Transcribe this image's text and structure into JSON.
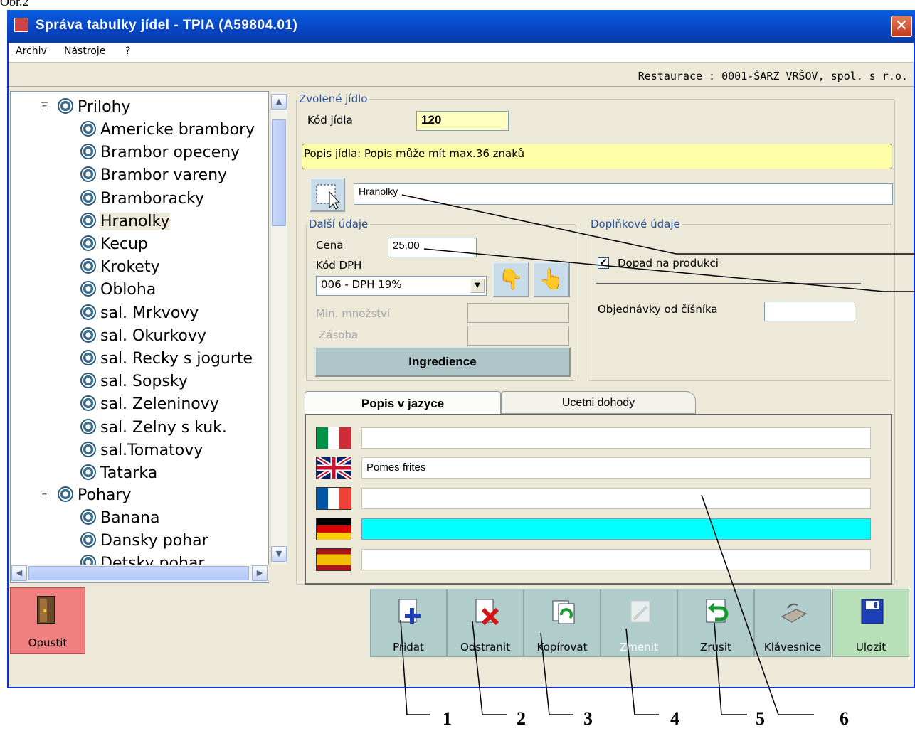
{
  "figure_label": "Obr.2",
  "window": {
    "title": "Správa tabulky jídel - TPIA (A59804.01)",
    "close_label": "✕"
  },
  "menu": [
    "Archiv",
    "Nástroje",
    "?"
  ],
  "restaurant": "Restaurace : 0001-ŠARZ VRŠOV, spol. s r.o.",
  "tree": {
    "groups": [
      {
        "label": "Prilohy",
        "items": [
          "Americke brambory",
          "Brambor opeceny",
          "Brambor vareny",
          "Bramboracky",
          "Hranolky",
          "Kecup",
          "Krokety",
          "Obloha",
          "sal. Mrkvovy",
          "sal. Okurkovy",
          "sal. Recky s jogurte",
          "sal. Sopsky",
          "sal. Zeleninovy",
          "sal. Zelny s kuk.",
          "sal.Tomatovy",
          "Tatarka"
        ]
      },
      {
        "label": "Pohary",
        "items": [
          "Banana",
          "Dansky pohar",
          "Detsky pohar"
        ]
      }
    ],
    "selected": "Hranolky"
  },
  "selected_food": {
    "legend": "Zvolené jídlo",
    "code_label": "Kód jídla",
    "code_value": "120",
    "hint": "Popis jídla: Popis může mít max.36 znaků",
    "description": "Hranolky"
  },
  "other_data": {
    "legend": "Další údaje",
    "price_label": "Cena",
    "price_value": "25,00",
    "vat_label": "Kód DPH",
    "vat_value": "006 - DPH 19%",
    "min_label": "Min. množství",
    "stock_label": "Zásoba",
    "ingredients_label": "Ingredience"
  },
  "extra_data": {
    "legend": "Doplňkové údaje",
    "production_label": "Dopad na produkci",
    "production_checked": true,
    "waiter_label": "Objednávky od číšníka"
  },
  "tabs": {
    "active": "Popis v jazyce",
    "other": "Ucetni dohody"
  },
  "languages": [
    {
      "flag": "italy",
      "value": ""
    },
    {
      "flag": "uk",
      "value": "Pomes frites"
    },
    {
      "flag": "france",
      "value": ""
    },
    {
      "flag": "germany",
      "value": ""
    },
    {
      "flag": "spain",
      "value": ""
    }
  ],
  "toolbar": {
    "quit": "Opustit",
    "buttons": [
      "Pridat",
      "Odstranit",
      "Kopírovat",
      "Zmenit",
      "Zrusit",
      "Klávesnice",
      "Ulozit"
    ]
  },
  "callouts": [
    "1",
    "2",
    "3",
    "4",
    "5",
    "6"
  ],
  "colors": {
    "titlebar": "#0746c6",
    "code_field": "#ffffc0",
    "active_field": "#00ffff",
    "quit_button": "#f08080",
    "toolbar": "#b0cccb"
  }
}
